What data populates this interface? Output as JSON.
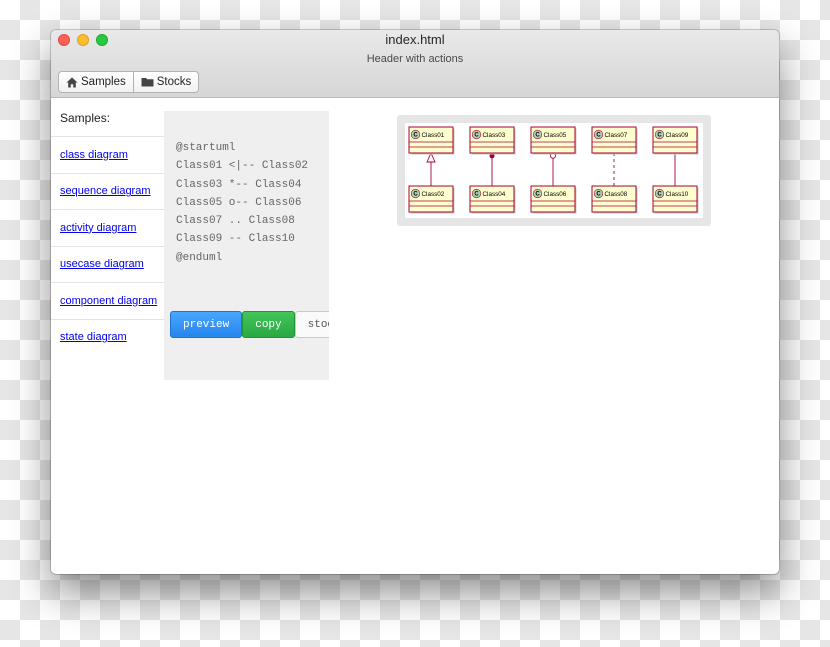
{
  "window": {
    "title": "index.html",
    "subtitle": "Header with actions"
  },
  "toolbar": {
    "samples_label": "Samples",
    "samples_icon": "home-icon",
    "stocks_label": "Stocks",
    "stocks_icon": "folder-icon"
  },
  "sidebar": {
    "heading": "Samples:",
    "items": [
      {
        "label": "class diagram"
      },
      {
        "label": "sequence diagram"
      },
      {
        "label": "activity diagram"
      },
      {
        "label": "usecase diagram"
      },
      {
        "label": "component diagram"
      },
      {
        "label": "state diagram"
      }
    ]
  },
  "editor": {
    "lines": [
      "@startuml",
      "Class01 <|-- Class02",
      "Class03 *-- Class04",
      "Class05 o-- Class06",
      "Class07 .. Class08",
      "Class09 -- Class10",
      "@enduml"
    ],
    "preview_label": "preview",
    "copy_label": "copy",
    "stocks_label": "stocks"
  },
  "diagram": {
    "pairs": [
      {
        "top": "Class01",
        "bottom": "Class02",
        "relation": "extension"
      },
      {
        "top": "Class03",
        "bottom": "Class04",
        "relation": "composition"
      },
      {
        "top": "Class05",
        "bottom": "Class06",
        "relation": "aggregation"
      },
      {
        "top": "Class07",
        "bottom": "Class08",
        "relation": "dotted"
      },
      {
        "top": "Class09",
        "bottom": "Class10",
        "relation": "plain"
      }
    ]
  },
  "colors": {
    "class_fill": "#fefece",
    "class_border": "#a80036",
    "class_badge": "#add1b2",
    "preview_button": "#2f8ff4",
    "copy_button": "#34b24c"
  }
}
